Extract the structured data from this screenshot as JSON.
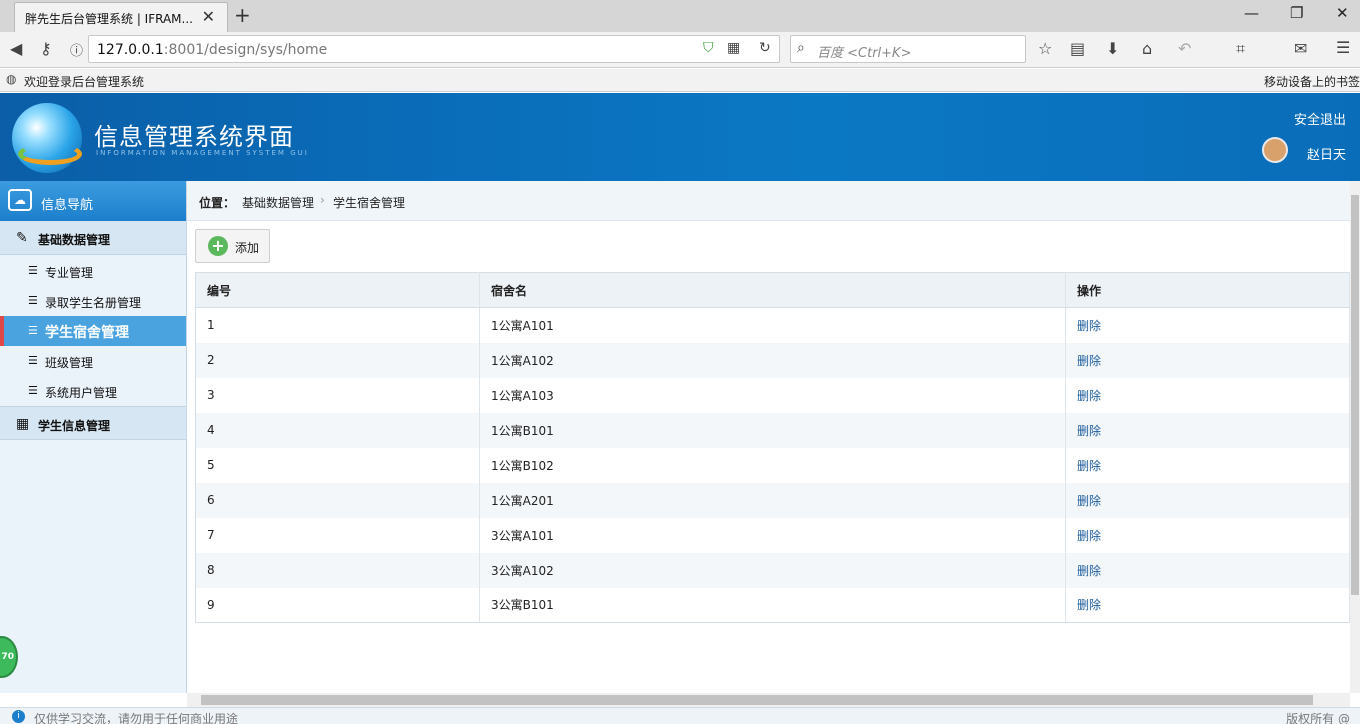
{
  "browser": {
    "tab_title": "胖先生后台管理系统 | IFRAM...",
    "url_host": "127.0.0.1",
    "url_path": ":8001/design/sys/home",
    "search_placeholder": "百度 <Ctrl+K>",
    "bookmark_left": "欢迎登录后台管理系统",
    "bookmark_right": "移动设备上的书签"
  },
  "header": {
    "title": "信息管理系统界面",
    "subtitle": "INFORMATION MANAGEMENT SYSTEM GUI",
    "logout": "安全退出",
    "username": "赵日天"
  },
  "sidebar": {
    "nav_title": "信息导航",
    "group1": "基础数据管理",
    "items": [
      {
        "label": "专业管理"
      },
      {
        "label": "录取学生名册管理"
      },
      {
        "label": "学生宿舍管理"
      },
      {
        "label": "班级管理"
      },
      {
        "label": "系统用户管理"
      }
    ],
    "group2": "学生信息管理"
  },
  "breadcrumb": {
    "prefix": "位置：",
    "parent": "基础数据管理",
    "current": "学生宿舍管理"
  },
  "toolbar": {
    "add_label": "添加"
  },
  "table": {
    "headers": [
      "编号",
      "宿舍名",
      "操作"
    ],
    "rows": [
      {
        "id": "1",
        "name": "1公寓A101",
        "action": "删除"
      },
      {
        "id": "2",
        "name": "1公寓A102",
        "action": "删除"
      },
      {
        "id": "3",
        "name": "1公寓A103",
        "action": "删除"
      },
      {
        "id": "4",
        "name": "1公寓B101",
        "action": "删除"
      },
      {
        "id": "5",
        "name": "1公寓B102",
        "action": "删除"
      },
      {
        "id": "6",
        "name": "1公寓A201",
        "action": "删除"
      },
      {
        "id": "7",
        "name": "3公寓A101",
        "action": "删除"
      },
      {
        "id": "8",
        "name": "3公寓A102",
        "action": "删除"
      },
      {
        "id": "9",
        "name": "3公寓B101",
        "action": "删除"
      }
    ]
  },
  "footer": {
    "left": "仅供学习交流，请勿用于任何商业用途",
    "right": "版权所有 @"
  },
  "badge": "70"
}
